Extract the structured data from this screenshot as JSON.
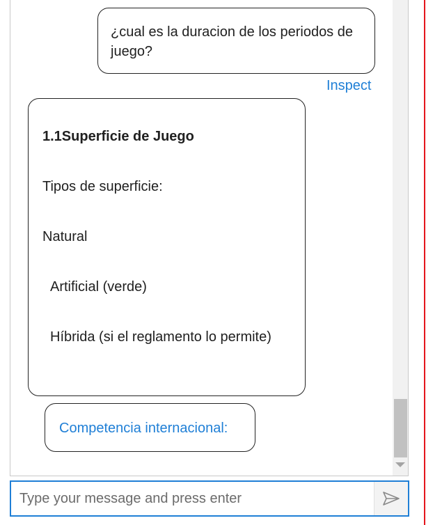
{
  "chat": {
    "user_message": "¿cual es la duracion de los periodos de juego?",
    "inspect_label": "Inspect",
    "bot_message": {
      "heading": "1.1Superficie de Juego",
      "para1": "Tipos de superficie:",
      "para2": "Natural",
      "para3": "Artificial (verde)",
      "para4": "Híbrida (si el reglamento lo permite)"
    },
    "suggestion_chip": "Competencia internacional:"
  },
  "input": {
    "placeholder": "Type your message and press enter",
    "value": ""
  },
  "icons": {
    "send": "send-icon",
    "scroll_down": "chevron-down-icon"
  },
  "colors": {
    "accent": "#1f7fd6",
    "focus_border": "#e4141b"
  }
}
